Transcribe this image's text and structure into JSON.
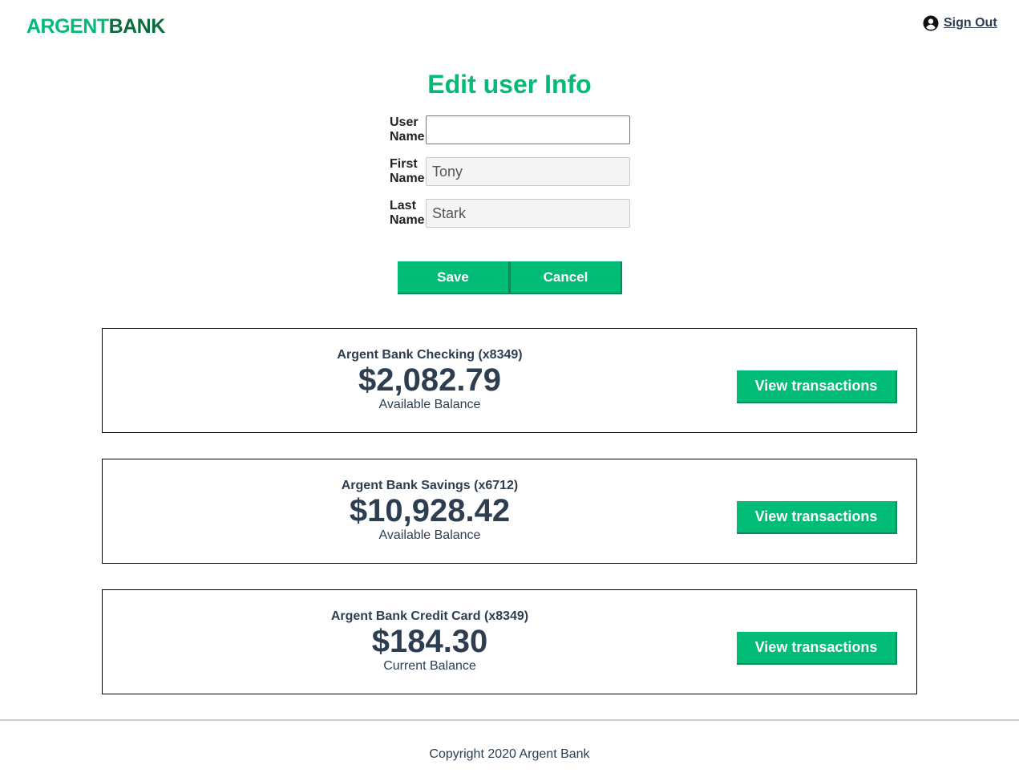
{
  "header": {
    "logo_part1": "ARGENT",
    "logo_part2": "BANK",
    "signout_label": "Sign Out",
    "signout_icon": "user-circle-icon"
  },
  "edit_form": {
    "title": "Edit user Info",
    "fields": [
      {
        "label_line1": "User",
        "label_line2": "Name",
        "value": "",
        "disabled": false
      },
      {
        "label_line1": "First",
        "label_line2": "Name",
        "value": "Tony",
        "disabled": true
      },
      {
        "label_line1": "Last",
        "label_line2": "Name",
        "value": "Stark",
        "disabled": true
      }
    ],
    "save_label": "Save",
    "cancel_label": "Cancel"
  },
  "accounts": [
    {
      "title": "Argent Bank Checking (x8349)",
      "amount": "$2,082.79",
      "description": "Available Balance",
      "button_label": "View transactions"
    },
    {
      "title": "Argent Bank Savings (x6712)",
      "amount": "$10,928.42",
      "description": "Available Balance",
      "button_label": "View transactions"
    },
    {
      "title": "Argent Bank Credit Card (x8349)",
      "amount": "$184.30",
      "description": "Current Balance",
      "button_label": "View transactions"
    }
  ],
  "footer": {
    "copyright": "Copyright 2020 Argent Bank"
  },
  "colors": {
    "accent": "#00bc77",
    "logo_dark": "#0a6b3f",
    "text": "#2c3e50"
  }
}
